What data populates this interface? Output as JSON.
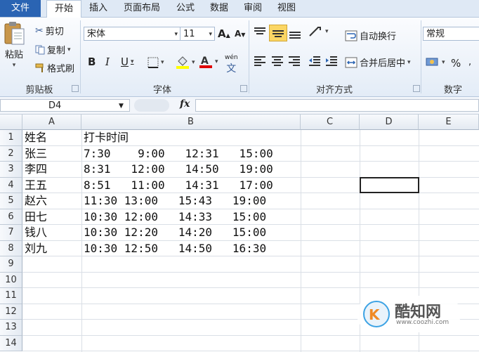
{
  "tabs": [
    "文件",
    "开始",
    "插入",
    "页面布局",
    "公式",
    "数据",
    "审阅",
    "视图"
  ],
  "clipboard": {
    "paste": "粘贴",
    "cut": "剪切",
    "copy": "复制",
    "format_painter": "格式刷",
    "label": "剪贴板"
  },
  "font": {
    "name": "宋体",
    "size": "11",
    "bold": "B",
    "italic": "I",
    "underline": "U",
    "label": "字体",
    "wen": "wén"
  },
  "alignment": {
    "wrap": "自动换行",
    "merge": "合并后居中",
    "label": "对齐方式"
  },
  "number": {
    "format": "常规",
    "percent": "%",
    "label": "数字"
  },
  "formula_bar": {
    "name_box": "D4",
    "fx": "fx",
    "value": ""
  },
  "columns": [
    "A",
    "B",
    "C",
    "D",
    "E"
  ],
  "rows": [
    "1",
    "2",
    "3",
    "4",
    "5",
    "6",
    "7",
    "8",
    "9",
    "10",
    "11",
    "12",
    "13",
    "14"
  ],
  "cells": [
    {
      "a": "姓名",
      "b": "打卡时间"
    },
    {
      "a": "张三",
      "b": "7:30    9:00   12:31   15:00"
    },
    {
      "a": "李四",
      "b": "8:31   12:00   14:50   19:00"
    },
    {
      "a": "王五",
      "b": "8:51   11:00   14:31   17:00"
    },
    {
      "a": "赵六",
      "b": "11:30 13:00   15:43   19:00"
    },
    {
      "a": "田七",
      "b": "10:30 12:00   14:33   15:00"
    },
    {
      "a": "钱八",
      "b": "10:30 12:20   14:20   15:00"
    },
    {
      "a": "刘九",
      "b": "10:30 12:50   14:50   16:30"
    }
  ],
  "watermark": {
    "name": "酷知网",
    "url": "www.coozhi.com"
  }
}
